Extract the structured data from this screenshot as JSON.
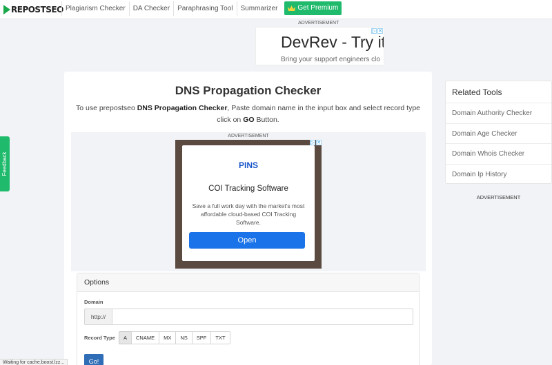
{
  "nav": {
    "logo_text": "REPOSTSEO",
    "items": [
      {
        "label": "Plagiarism Checker"
      },
      {
        "label": "DA Checker"
      },
      {
        "label": "Paraphrasing Tool"
      },
      {
        "label": "Summarizer"
      }
    ],
    "premium_label": "Get Premium",
    "premium_icon": "crown-icon"
  },
  "ads": {
    "top_label": "ADVERTISEMENT",
    "top_headline": "DevRev - Try it",
    "top_sub": "Bring your support engineers clo",
    "mid_label": "ADVERTISEMENT",
    "mid_brand": "PINS",
    "mid_title": "COI Tracking Software",
    "mid_desc": "Save a full work day with the market's most affordable cloud-based COI Tracking Software.",
    "mid_button": "Open",
    "side_label": "ADVERTISEMENT"
  },
  "main": {
    "title": "DNS Propagation Checker",
    "intro_1": "To use prepostseo ",
    "intro_bold": "DNS Propagation Checker",
    "intro_2": ", Paste domain name in the input box and select record type click on ",
    "intro_go": "GO",
    "intro_3": " Button."
  },
  "options": {
    "heading": "Options",
    "domain_label": "Domain",
    "domain_prefix": "http://",
    "domain_value": "",
    "domain_placeholder": "",
    "record_type_label": "Record Type",
    "record_types": [
      "A",
      "CNAME",
      "MX",
      "NS",
      "SPF",
      "TXT"
    ],
    "selected_record_type": "A",
    "go_label": "Go!"
  },
  "sidebar": {
    "title": "Related Tools",
    "items": [
      {
        "label": "Domain Authority Checker"
      },
      {
        "label": "Domain Age Checker"
      },
      {
        "label": "Domain Whois Checker"
      },
      {
        "label": "Domain Ip History"
      }
    ]
  },
  "feedback_label": "Feedback",
  "status_text": "Waiting for cache.boost.lzz...",
  "colors": {
    "brand_green": "#1fba6b",
    "go_blue": "#2f6db6",
    "ad_button_blue": "#1a73e8"
  }
}
